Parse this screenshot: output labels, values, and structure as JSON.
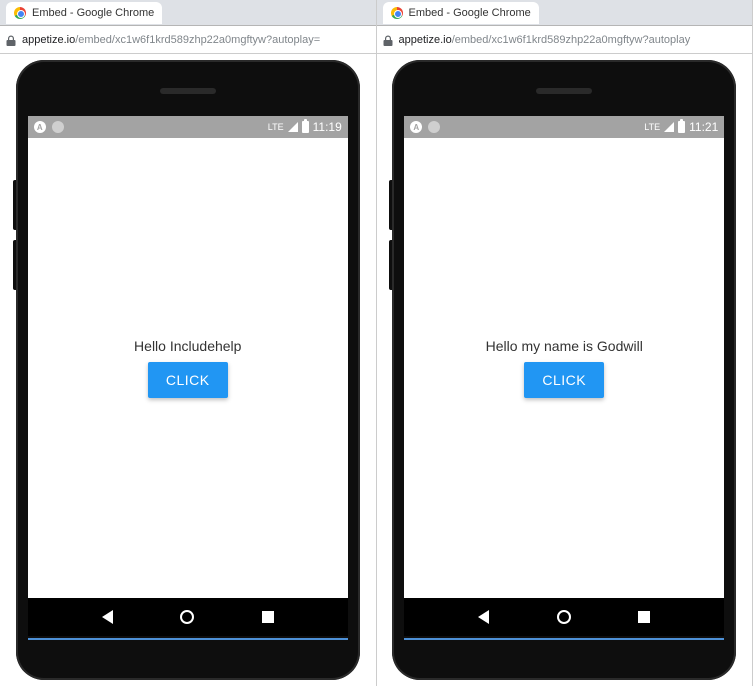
{
  "windows": [
    {
      "tab_title": "Embed - Google Chrome",
      "url_host": "appetize.io",
      "url_path": "/embed/xc1w6f1krd589zhp22a0mgftyw?autoplay=",
      "status_time": "11:19",
      "network_label": "LTE",
      "message": "Hello Includehelp",
      "button_label": "CLICK"
    },
    {
      "tab_title": "Embed - Google Chrome",
      "url_host": "appetize.io",
      "url_path": "/embed/xc1w6f1krd589zhp22a0mgftyw?autoplay",
      "status_time": "11:21",
      "network_label": "LTE",
      "message": "Hello my name is Godwill",
      "button_label": "CLICK"
    }
  ]
}
